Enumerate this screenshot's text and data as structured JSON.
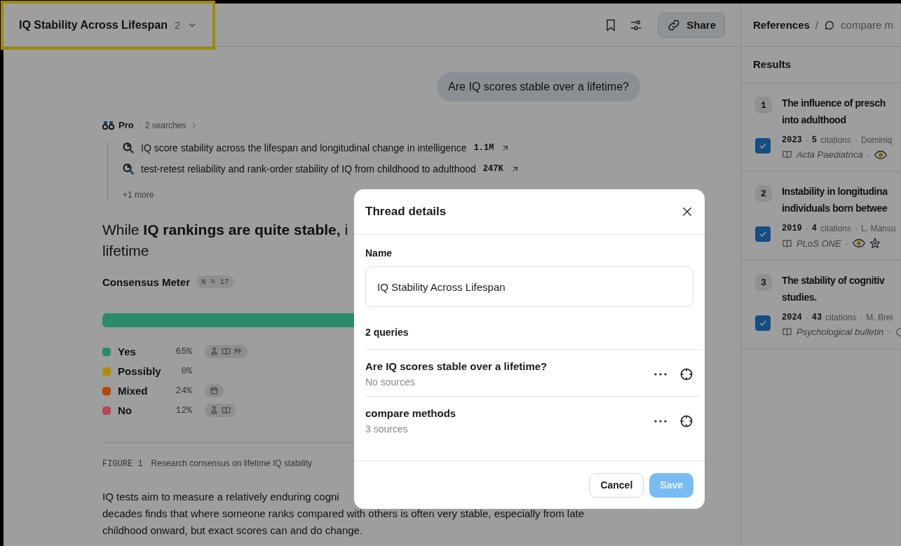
{
  "header": {
    "title": "IQ Stability Across Lifespan",
    "count": "2",
    "share": "Share"
  },
  "highlight": true,
  "user_message": "Are IQ scores stable over a lifetime?",
  "pro": {
    "label": "Pro",
    "separator": "·",
    "searches_label": "2 searches",
    "searches": [
      {
        "text": "IQ score stability across the lifespan and longitudinal change in intelligence",
        "count": "1.1M"
      },
      {
        "text": "test-retest reliability and rank-order stability of IQ from childhood to adulthood",
        "count": "247K"
      }
    ],
    "more": "+1 more"
  },
  "answer_heading": [
    "While **IQ rankings are quite stable,** i",
    "lifetime"
  ],
  "consensus": {
    "title": "Consensus Meter",
    "n_badge": "N = 17",
    "items": [
      {
        "label": "Yes",
        "percent": "65%",
        "color": "#2a8a6c",
        "badges": [
          {
            "kind": "flask"
          },
          {
            "kind": "book"
          },
          {
            "kind": "quote"
          }
        ]
      },
      {
        "label": "Possibly",
        "percent": "0%",
        "color": "#b08a00"
      },
      {
        "label": "Mixed",
        "percent": "24%",
        "color": "#b04a08",
        "badges": [
          {
            "kind": "calendar"
          }
        ]
      },
      {
        "label": "No",
        "percent": "12%",
        "color": "#b84850",
        "badges": [
          {
            "kind": "flask"
          },
          {
            "kind": "book"
          }
        ]
      }
    ]
  },
  "figure": {
    "label": "FIGURE 1",
    "caption": "Research consensus on lifetime IQ stability"
  },
  "paragraph_lines": [
    "IQ tests aim to measure a relatively enduring cogni",
    "decades finds that where someone ranks compared with others is often very stable, especially from late",
    "childhood onward, but exact scores can and do change."
  ],
  "references": {
    "title": "References",
    "separator": "/",
    "thread": "compare m",
    "results_label": "Results",
    "items": [
      {
        "number": "1",
        "title_lines": [
          "The influence of presch",
          "into adulthood"
        ],
        "meta": [
          {
            "kind": "num",
            "text": "2023"
          },
          {
            "kind": "sep",
            "text": "·"
          },
          {
            "kind": "num",
            "text": "5"
          },
          {
            "kind": "text",
            "text": "citations"
          },
          {
            "kind": "sep",
            "text": "·"
          },
          {
            "kind": "text",
            "text": "Dominiq"
          }
        ],
        "journal": "Acta Paediatrica",
        "journal_separator": "·",
        "checked": true,
        "icons": [
          {
            "kind": "eye"
          }
        ]
      },
      {
        "number": "2",
        "title_lines": [
          "Instability in longitudina",
          "individuals born betwee"
        ],
        "meta": [
          {
            "kind": "num",
            "text": "2019"
          },
          {
            "kind": "sep",
            "text": "·"
          },
          {
            "kind": "num",
            "text": "4"
          },
          {
            "kind": "text",
            "text": "citations"
          },
          {
            "kind": "sep",
            "text": "·"
          },
          {
            "kind": "text",
            "text": "L. Mansu"
          }
        ],
        "journal": "PLoS ONE",
        "journal_separator": "·",
        "checked": true,
        "icons": [
          {
            "kind": "eye"
          },
          {
            "kind": "star"
          }
        ]
      },
      {
        "number": "3",
        "title_lines": [
          "The stability of cognitiv",
          "studies."
        ],
        "meta": [
          {
            "kind": "num",
            "text": "2024"
          },
          {
            "kind": "sep",
            "text": "·"
          },
          {
            "kind": "num",
            "text": "43"
          },
          {
            "kind": "text",
            "text": "citations"
          },
          {
            "kind": "sep",
            "text": "·"
          },
          {
            "kind": "text",
            "text": "M. Brei"
          }
        ],
        "journal": "Psychological bulletin",
        "journal_separator": "·",
        "checked": true,
        "icons": [
          {
            "kind": "circle"
          }
        ]
      }
    ]
  },
  "modal": {
    "title": "Thread details",
    "name_label": "Name",
    "name_value": "IQ Stability Across Lifespan",
    "queries_label": "2 queries",
    "queries": [
      {
        "title": "Are IQ scores stable over a lifetime?",
        "subtitle": "No sources"
      },
      {
        "title": "compare methods",
        "subtitle": "3 sources"
      }
    ],
    "cancel": "Cancel",
    "save": "Save",
    "save_disabled": true
  }
}
